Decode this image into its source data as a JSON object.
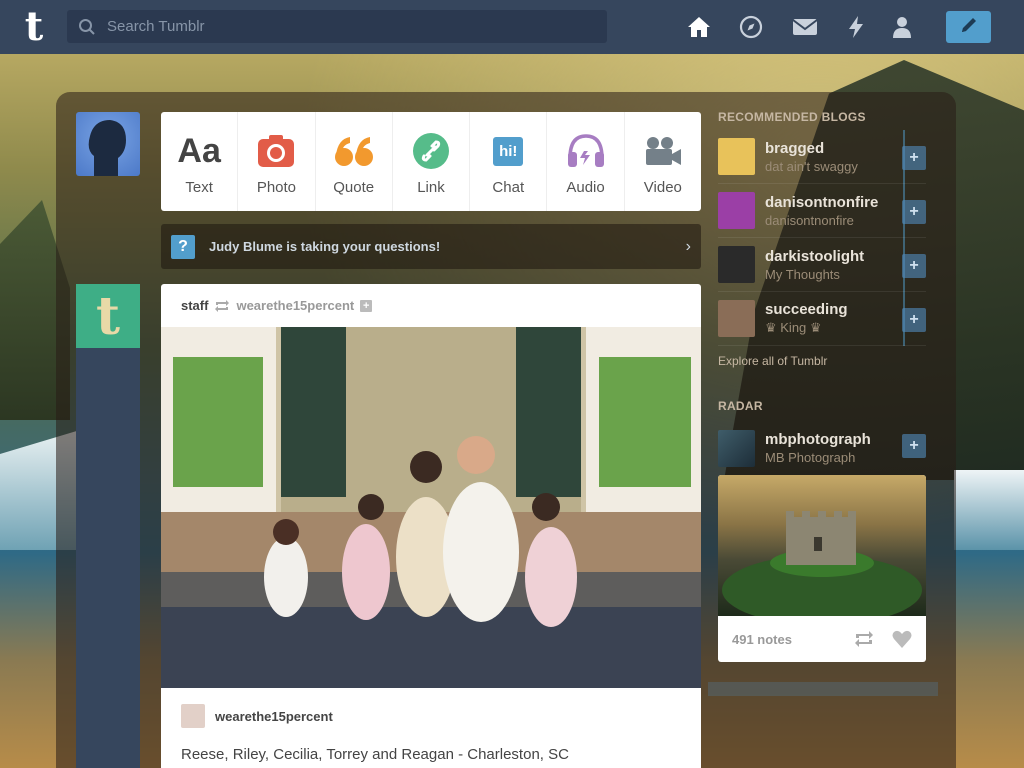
{
  "topbar": {
    "logo": "t",
    "search_placeholder": "Search Tumblr",
    "nav": [
      {
        "name": "home-icon"
      },
      {
        "name": "explore-compass-icon"
      },
      {
        "name": "messages-mail-icon"
      },
      {
        "name": "activity-lightning-icon"
      },
      {
        "name": "account-person-icon"
      }
    ],
    "compose_icon": "pencil-icon"
  },
  "post_types": [
    {
      "label": "Text",
      "icon": "text-icon",
      "glyph": "Aa"
    },
    {
      "label": "Photo",
      "icon": "camera-icon"
    },
    {
      "label": "Quote",
      "icon": "quote-icon",
      "glyph": "66"
    },
    {
      "label": "Link",
      "icon": "link-icon"
    },
    {
      "label": "Chat",
      "icon": "chat-icon",
      "glyph": "hi!"
    },
    {
      "label": "Audio",
      "icon": "headphones-icon"
    },
    {
      "label": "Video",
      "icon": "video-camera-icon"
    }
  ],
  "banner": {
    "badge": "?",
    "text": "Judy Blume is taking your questions!"
  },
  "post": {
    "author": "staff",
    "reblogged_from": "wearethe15percent",
    "source_name": "wearethe15percent",
    "caption": "Reese, Riley, Cecilia, Torrey and Reagan - Charleston, SC"
  },
  "sidebar": {
    "recommended_title": "RECOMMENDED BLOGS",
    "blogs": [
      {
        "name": "bragged",
        "sub": "dat ain't swaggy",
        "color": "#e8c25a"
      },
      {
        "name": "danisontnonfire",
        "sub": "danisontnonfire",
        "color": "#9b3fa6"
      },
      {
        "name": "darkistoolight",
        "sub": "My Thoughts",
        "color": "#2a2a2a"
      },
      {
        "name": "succeeding",
        "sub": "♛ King ♛",
        "color": "#8a6d57"
      }
    ],
    "explore_text": "Explore all of Tumblr",
    "radar_title": "RADAR",
    "radar": {
      "name": "mbphotograph",
      "sub": "MB Photograph",
      "notes": "491 notes"
    }
  },
  "colors": {
    "topbar": "#36465d",
    "accent": "#529ecc"
  }
}
